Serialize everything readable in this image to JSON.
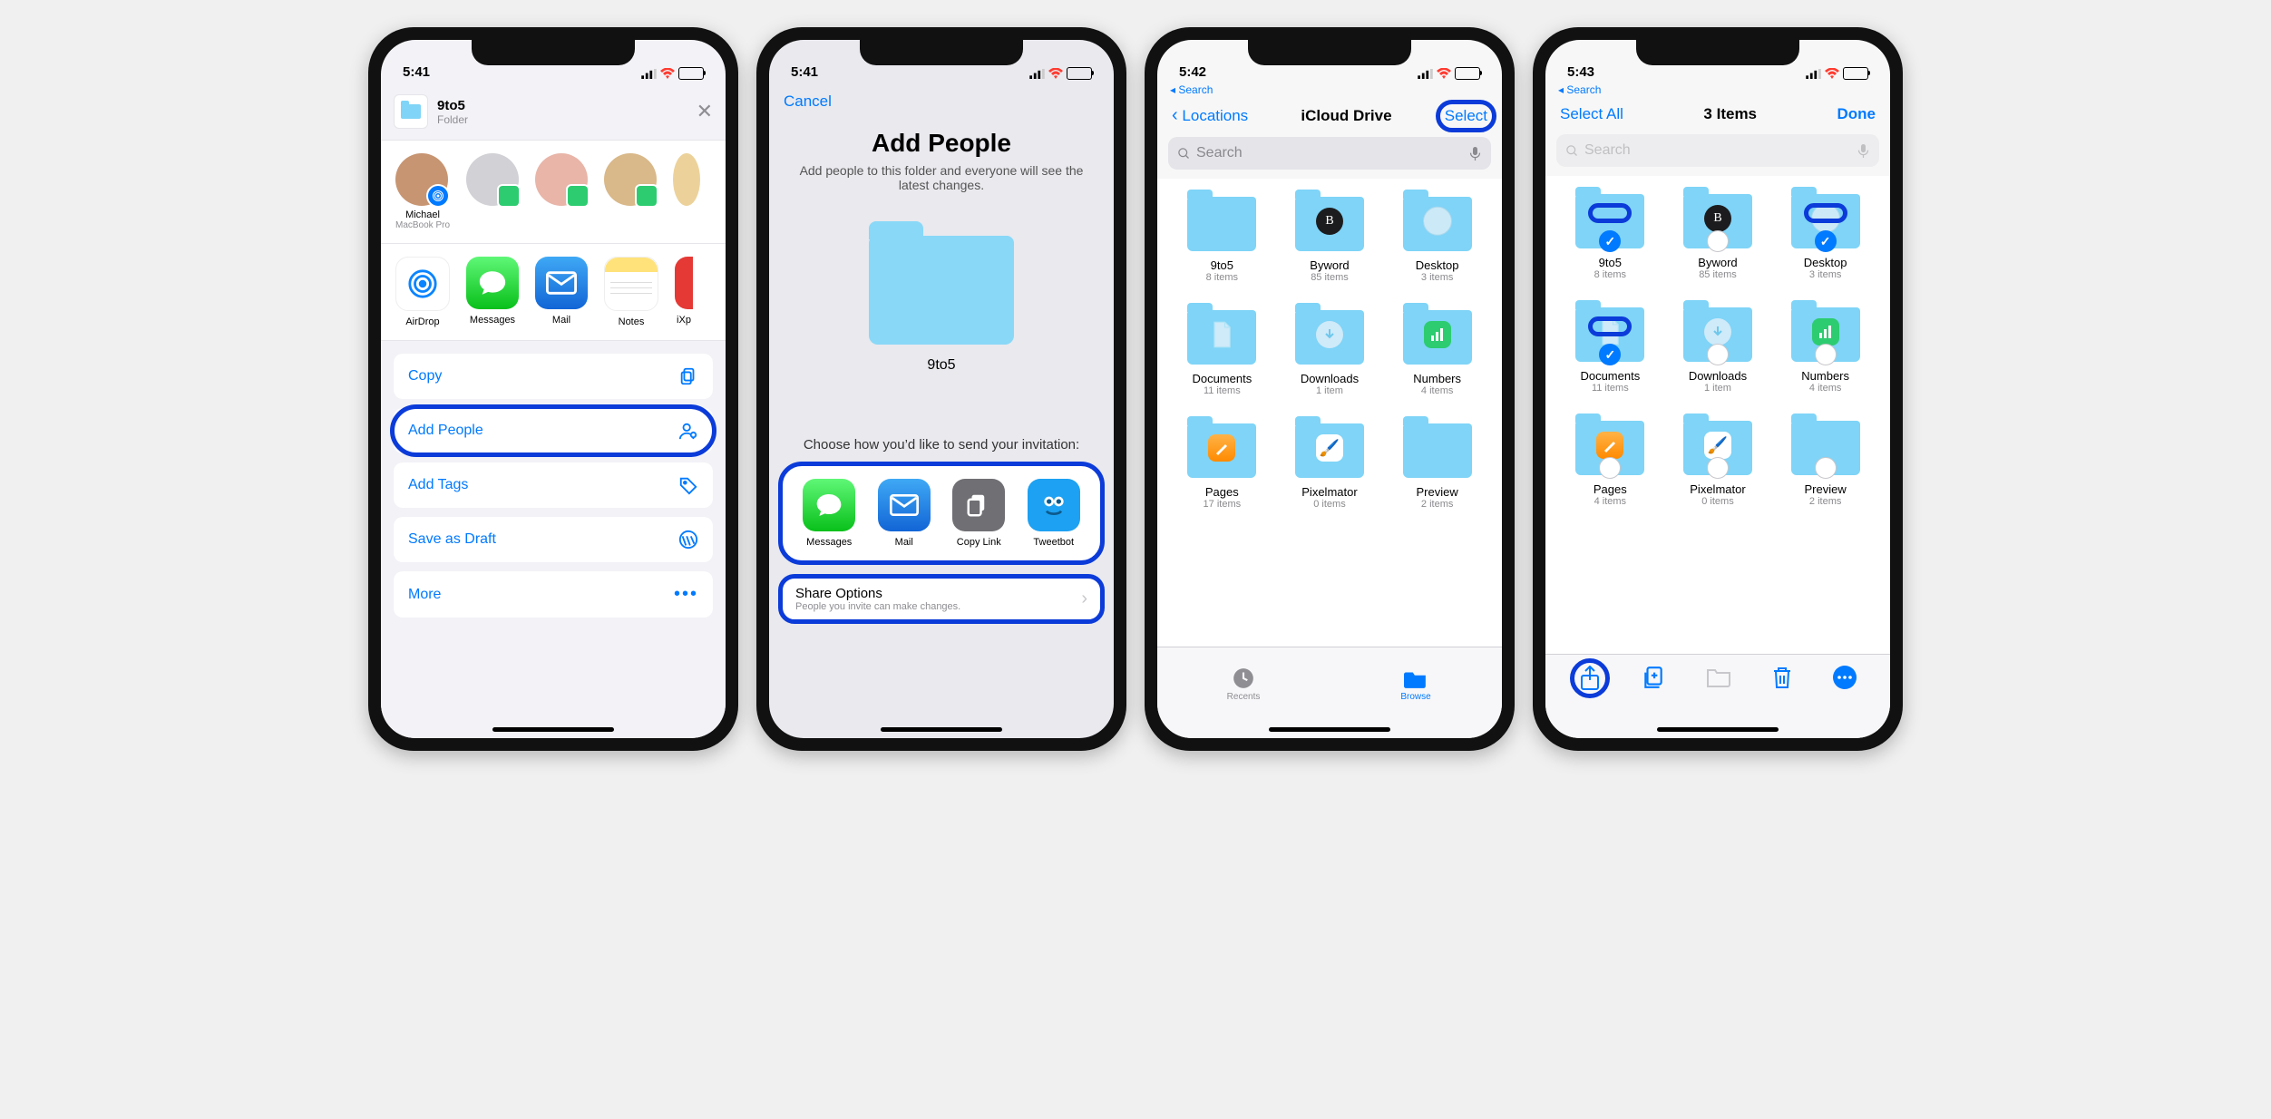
{
  "status": {
    "time1": "5:41",
    "time2": "5:41",
    "time3": "5:42",
    "time4": "5:43"
  },
  "backSearch": "Search",
  "s1": {
    "item_name": "9to5",
    "item_type": "Folder",
    "contacts": [
      {
        "name": "Michael",
        "sub": "MacBook Pro"
      },
      {
        "name": "",
        "sub": ""
      },
      {
        "name": "",
        "sub": ""
      },
      {
        "name": "",
        "sub": ""
      }
    ],
    "apps": [
      "AirDrop",
      "Messages",
      "Mail",
      "Notes",
      "iXp"
    ],
    "actions": [
      "Copy",
      "Add People",
      "Add Tags",
      "Save as Draft",
      "More"
    ]
  },
  "s2": {
    "cancel": "Cancel",
    "title": "Add People",
    "subtitle": "Add people to this folder and everyone will see the latest changes.",
    "folder": "9to5",
    "choose": "Choose how you’d like to send your invitation:",
    "apps": [
      "Messages",
      "Mail",
      "Copy Link",
      "Tweetbot"
    ],
    "share_title": "Share Options",
    "share_sub": "People you invite can make changes."
  },
  "s3": {
    "back": "Locations",
    "title": "iCloud Drive",
    "select": "Select",
    "search_placeholder": "Search",
    "folders": [
      {
        "name": "9to5",
        "sub": "8 items",
        "overlay": ""
      },
      {
        "name": "Byword",
        "sub": "85 items",
        "overlay": "B"
      },
      {
        "name": "Desktop",
        "sub": "3 items",
        "overlay": "win"
      },
      {
        "name": "Documents",
        "sub": "11 items",
        "overlay": "doc"
      },
      {
        "name": "Downloads",
        "sub": "1 item",
        "overlay": "dl"
      },
      {
        "name": "Numbers",
        "sub": "4 items",
        "overlay": "num"
      },
      {
        "name": "Pages",
        "sub": "17 items",
        "overlay": "pages"
      },
      {
        "name": "Pixelmator",
        "sub": "0 items",
        "overlay": "pixel"
      },
      {
        "name": "Preview",
        "sub": "2 items",
        "overlay": ""
      }
    ],
    "tabs": {
      "recents": "Recents",
      "browse": "Browse"
    }
  },
  "s4": {
    "selectAll": "Select All",
    "title": "3 Items",
    "done": "Done",
    "search_placeholder": "Search",
    "folders": [
      {
        "name": "9to5",
        "sub": "8 items",
        "selected": true
      },
      {
        "name": "Byword",
        "sub": "85 items",
        "selected": false,
        "overlay": "B"
      },
      {
        "name": "Desktop",
        "sub": "3 items",
        "selected": true,
        "overlay": "win"
      },
      {
        "name": "Documents",
        "sub": "11 items",
        "selected": true,
        "overlay": "doc"
      },
      {
        "name": "Downloads",
        "sub": "1 item",
        "selected": false,
        "overlay": "dl"
      },
      {
        "name": "Numbers",
        "sub": "4 items",
        "selected": false,
        "overlay": "num"
      },
      {
        "name": "Pages",
        "sub": "4 items",
        "selected": false,
        "overlay": "pages"
      },
      {
        "name": "Pixelmator",
        "sub": "0 items",
        "selected": false,
        "overlay": "pixel"
      },
      {
        "name": "Preview",
        "sub": "2 items",
        "selected": false
      }
    ]
  }
}
